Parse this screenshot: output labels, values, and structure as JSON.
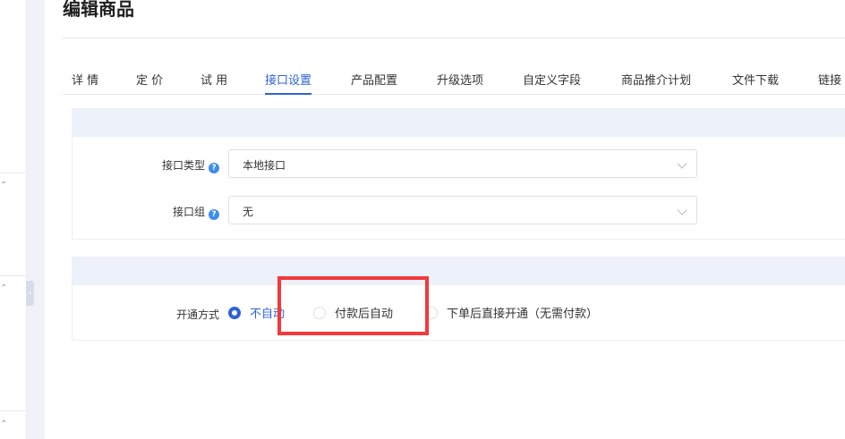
{
  "page": {
    "title": "编辑商品"
  },
  "tabs": [
    {
      "label": "详 情"
    },
    {
      "label": "定 价"
    },
    {
      "label": "试 用"
    },
    {
      "label": "接口设置",
      "active": true
    },
    {
      "label": "产品配置"
    },
    {
      "label": "升级选项"
    },
    {
      "label": "自定义字段"
    },
    {
      "label": "商品推介计划"
    },
    {
      "label": "文件下载"
    },
    {
      "label": "链接"
    }
  ],
  "interface_panel": {
    "interface_type": {
      "label": "接口类型",
      "value": "本地接口",
      "help_icon": "question-circle-icon"
    },
    "interface_group": {
      "label": "接口组",
      "value": "无",
      "help_icon": "question-circle-icon"
    }
  },
  "activation_panel": {
    "label": "开通方式",
    "options": [
      {
        "label": "不自动",
        "checked": true
      },
      {
        "label": "付款后自动",
        "checked": false
      },
      {
        "label": "下单后直接开通（无需付款）",
        "checked": false
      }
    ]
  },
  "colors": {
    "accent": "#2f63d6",
    "highlight": "#f2393b",
    "panel_header": "#edf1fa",
    "help": "#3d8cf0"
  }
}
